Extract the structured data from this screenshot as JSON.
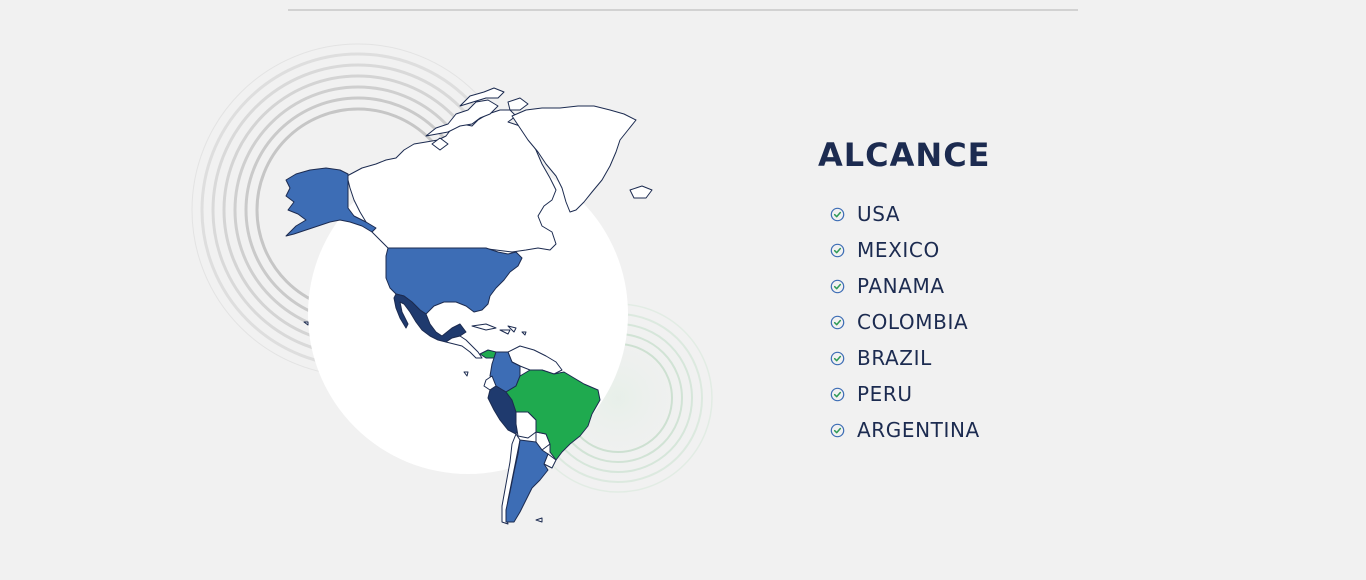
{
  "reach": {
    "title": "ALCANCE",
    "countries": [
      "USA",
      "MEXICO",
      "PANAMA",
      "COLOMBIA",
      "BRAZIL",
      "PERU",
      "ARGENTINA"
    ]
  },
  "icons": {
    "list_marker": "check-circle-icon"
  },
  "colors": {
    "background": "#f1f1f1",
    "heading": "#1c2b50",
    "medium_blue": "#3d6db5",
    "dark_navy": "#1f3a6e",
    "green": "#1faa4f",
    "check": "#2f9a57",
    "outline": "#1c2b50"
  }
}
